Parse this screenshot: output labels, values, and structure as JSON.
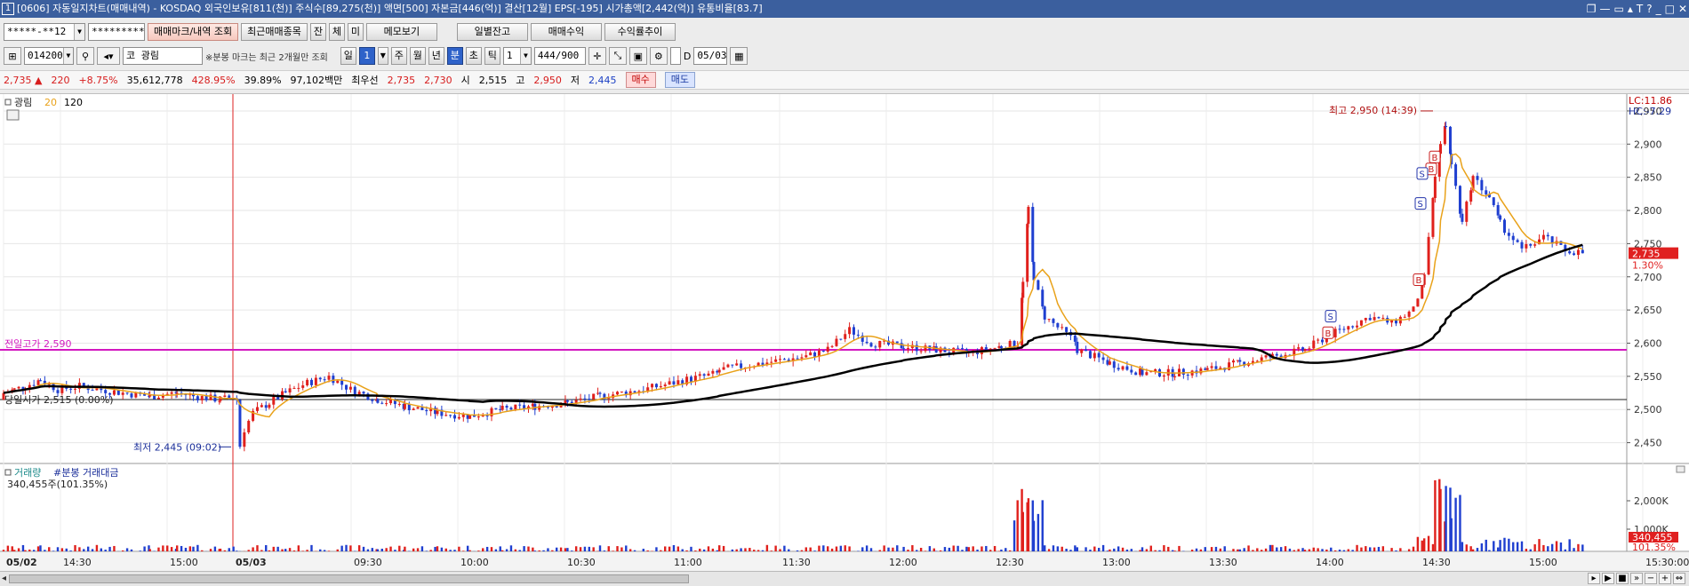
{
  "title": "[0606] 자동일지차트(매매내역) - KOSDAQ 외국인보유[811(천)] 주식수[89,275(천)] 액면[500] 자본금[446(억)] 결산[12월] EPS[-195] 시가총액[2,442(억)] 유통비율[83.7]",
  "window_number": "1",
  "window_controls": [
    "❐",
    "—",
    "▭",
    "▴",
    "T",
    "?",
    "_",
    "□",
    "✕"
  ],
  "toolbar1": {
    "account": "*****-**12",
    "password": "*********",
    "buttons": [
      "매매마크/내역 조회",
      "최근매매종목",
      "잔",
      "체",
      "미",
      "메모보기",
      "일별잔고",
      "매매수익",
      "수익률추이"
    ]
  },
  "toolbar2": {
    "code": "014200",
    "market": "코",
    "name": "광림",
    "note": "※분봉 마크는 최근 2개월만 조회",
    "periods": [
      "일",
      "1",
      "주",
      "월",
      "년",
      "분",
      "초",
      "틱"
    ],
    "selected_period": "분",
    "interval": "1",
    "count": "444",
    "count_total": "/900",
    "date": "05/03"
  },
  "quote": {
    "price": "2,735",
    "arrow": "▲",
    "change": "220",
    "rate": "+8.75%",
    "volume": "35,612,778",
    "vol_ratio": "428.95%",
    "turnover": "39.89%",
    "amount": "97,102백만",
    "best_label": "최우선",
    "ask": "2,735",
    "bid": "2,730",
    "open_label": "시",
    "open": "2,515",
    "high_label": "고",
    "high": "2,950",
    "low_label": "저",
    "low": "2,445",
    "buy": "매수",
    "sell": "매도"
  },
  "legend": {
    "name": "광림",
    "ma1": "20",
    "ma2": "120",
    "lc": "LC:11.86",
    "hc": "HC:-7.29"
  },
  "annotations": {
    "prev_high": "전일고가 2,590",
    "today_open": "당일시가 2,515 (0.00%)",
    "low": "최저 2,445 (09:02)",
    "high": "최고 2,950 (14:39)",
    "last_price": "2,735",
    "last_pct": "1.30%"
  },
  "volume_panel": {
    "title": "거래량",
    "title2": "#분봉 거래대금",
    "value": "340,455주(101.35%)",
    "last": "340,455",
    "last_pct": "101.35%",
    "ticks": [
      "2,000K",
      "1,000K"
    ]
  },
  "price_ticks": [
    "2,950",
    "2,900",
    "2,850",
    "2,800",
    "2,750",
    "2,700",
    "2,650",
    "2,600",
    "2,550",
    "2,500",
    "2,450"
  ],
  "time_labels": [
    "05/02",
    "14:30",
    "15:00",
    "05/03",
    "09:30",
    "10:00",
    "10:30",
    "11:00",
    "11:30",
    "12:00",
    "12:30",
    "13:00",
    "13:30",
    "14:00",
    "14:30",
    "15:00",
    "15:30:00"
  ],
  "colors": {
    "up": "#e0201c",
    "down": "#1f3fd0",
    "ma20": "#e9a21a",
    "ma120": "#000000",
    "prev_high": "#d319c0",
    "title_bg": "#3b5f9e"
  },
  "chart_data": {
    "type": "candlestick",
    "prev_high": 2590,
    "today_open": 2515,
    "high": 2950,
    "low": 2445,
    "last": 2735,
    "ylim": [
      2420,
      2970
    ],
    "segments": [
      {
        "x": [
          0,
          10,
          20,
          34,
          50,
          70,
          90,
          110,
          135,
          160,
          175,
          200,
          215
        ],
        "y": [
          2525,
          2530,
          2535,
          2545,
          2530,
          2535,
          2530,
          2525,
          2520,
          2525,
          2520,
          2515,
          2520
        ]
      },
      {
        "x": [
          215,
          218,
          222,
          230,
          245,
          260,
          280,
          300,
          320,
          345,
          370,
          400,
          430,
          460,
          490,
          520,
          550,
          590,
          630,
          660
        ],
        "y": [
          2515,
          2445,
          2470,
          2495,
          2510,
          2525,
          2540,
          2550,
          2530,
          2515,
          2505,
          2495,
          2490,
          2500,
          2505,
          2510,
          2520,
          2530,
          2545,
          2555
        ]
      },
      {
        "x": [
          660,
          700,
          740,
          760,
          780,
          800,
          830,
          860,
          890,
          920,
          935,
          940,
          945,
          950,
          960,
          990
        ],
        "y": [
          2560,
          2570,
          2580,
          2590,
          2620,
          2600,
          2595,
          2590,
          2585,
          2595,
          2600,
          2690,
          2800,
          2700,
          2640,
          2600
        ]
      },
      {
        "x": [
          990,
          1020,
          1050,
          1080,
          1110,
          1140,
          1170,
          1200,
          1220,
          1240,
          1260,
          1280,
          1300,
          1310,
          1320,
          1325,
          1330,
          1335,
          1345,
          1355,
          1370,
          1380,
          1400,
          1420,
          1440,
          1460
        ],
        "y": [
          2590,
          2570,
          2555,
          2555,
          2560,
          2570,
          2580,
          2590,
          2610,
          2625,
          2640,
          2630,
          2650,
          2700,
          2850,
          2900,
          2930,
          2870,
          2780,
          2850,
          2820,
          2780,
          2740,
          2760,
          2740,
          2735
        ]
      }
    ]
  }
}
